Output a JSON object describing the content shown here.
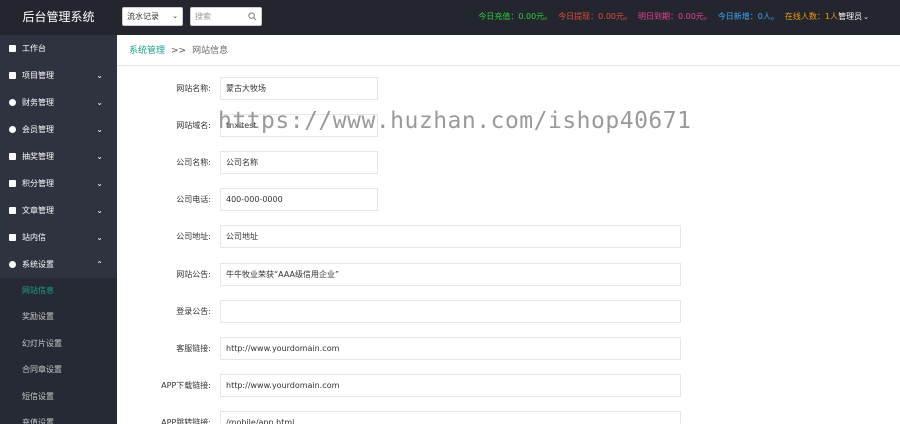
{
  "header": {
    "brand": "后台管理系统",
    "select_value": "流水记录",
    "search_placeholder": "搜索",
    "stats": [
      {
        "text": "今日充值：0.00元。",
        "color": "#2ecc40"
      },
      {
        "text": "今日提现：0.00元。",
        "color": "#e74c3c"
      },
      {
        "text": "明日到期：0.00元。",
        "color": "#e84393"
      },
      {
        "text": "今日新增：0人。",
        "color": "#3fa9f5"
      },
      {
        "text": "在线人数：1人",
        "color": "#f39c12"
      }
    ],
    "admin_label": "管理员"
  },
  "sidebar": {
    "items": [
      {
        "label": "工作台",
        "icon": "dashboard-icon",
        "arrow": ""
      },
      {
        "label": "项目管理",
        "icon": "document-icon",
        "arrow": "⌄"
      },
      {
        "label": "财务管理",
        "icon": "money-icon",
        "arrow": "⌄"
      },
      {
        "label": "会员管理",
        "icon": "user-icon",
        "arrow": "⌄"
      },
      {
        "label": "抽奖管理",
        "icon": "gift-icon",
        "arrow": "⌄"
      },
      {
        "label": "积分管理",
        "icon": "points-icon",
        "arrow": "⌄"
      },
      {
        "label": "文章管理",
        "icon": "article-icon",
        "arrow": "⌄"
      },
      {
        "label": "站内信",
        "icon": "message-icon",
        "arrow": "⌄"
      },
      {
        "label": "系统设置",
        "icon": "gear-icon",
        "arrow": "⌃"
      }
    ],
    "sub_items": [
      {
        "label": "网站信息",
        "active": true
      },
      {
        "label": "奖励设置",
        "active": false
      },
      {
        "label": "幻灯片设置",
        "active": false
      },
      {
        "label": "合同章设置",
        "active": false
      },
      {
        "label": "短信设置",
        "active": false
      },
      {
        "label": "充值设置",
        "active": false
      }
    ]
  },
  "breadcrumb": {
    "parent": "系统管理",
    "separator": ">>",
    "current": "网站信息"
  },
  "form": {
    "fields": [
      {
        "label": "网站名称:",
        "value": "蒙古大牧场"
      },
      {
        "label": "网站域名:",
        "value": "tnxitest"
      },
      {
        "label": "公司名称:",
        "value": "公司名称"
      },
      {
        "label": "公司电话:",
        "value": "400-000-0000"
      },
      {
        "label": "公司地址:",
        "value": "公司地址"
      },
      {
        "label": "网站公告:",
        "value": "牛牛牧业荣获“AAA级信用企业”"
      },
      {
        "label": "登录公告:",
        "value": ""
      },
      {
        "label": "客服链接:",
        "value": "http://www.yourdomain.com"
      },
      {
        "label": "APP下载链接:",
        "value": "http://www.yourdomain.com"
      },
      {
        "label": "APP跳转链接:",
        "value": "/mobile/app.html"
      }
    ]
  },
  "watermark": "https://www.huzhan.com/ishop40671"
}
